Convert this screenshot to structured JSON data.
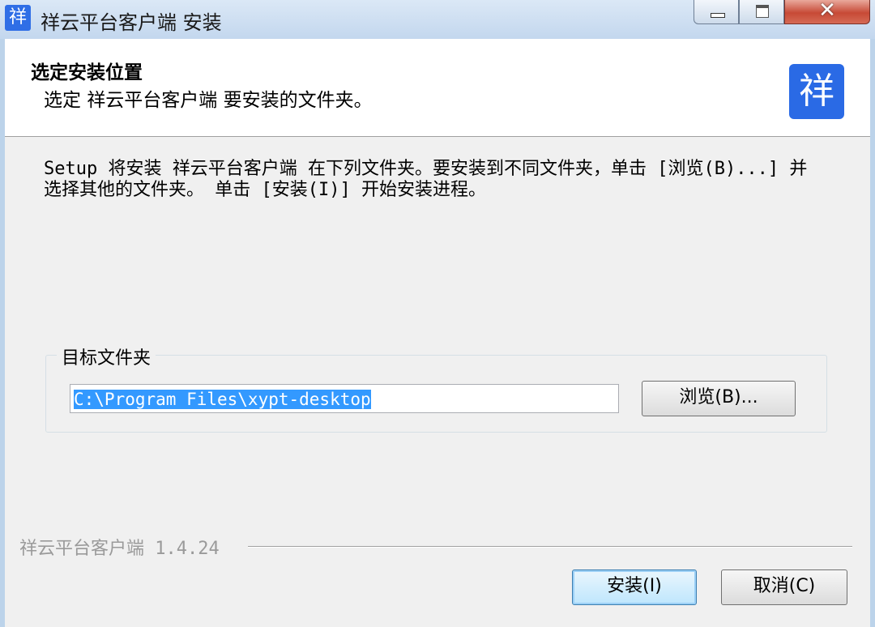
{
  "window": {
    "title": "祥云平台客户端 安装",
    "app_icon_glyph": "祥",
    "controls": {
      "minimize": "minimize-icon",
      "maximize": "maximize-icon",
      "close_glyph": "✕"
    }
  },
  "header": {
    "title": "选定安装位置",
    "subtitle": "选定 祥云平台客户端 要安装的文件夹。",
    "logo_glyph": "祥",
    "logo_color": "#2a6ae5"
  },
  "body": {
    "description": "Setup 将安装 祥云平台客户端 在下列文件夹。要安装到不同文件夹，单击 [浏览(B)...] 并选择其他的文件夹。 单击 [安装(I)] 开始安装进程。"
  },
  "destination": {
    "group_label": "目标文件夹",
    "path_value": "C:\\Program Files\\xypt-desktop",
    "browse_label": "浏览(B)..."
  },
  "footer": {
    "version_text": "祥云平台客户端 1.4.24",
    "install_label": "安装(I)",
    "cancel_label": "取消(C)"
  },
  "colors": {
    "selection": "#3399ff",
    "title_bar": "#c3d7ee",
    "close_button": "#c74a36"
  }
}
